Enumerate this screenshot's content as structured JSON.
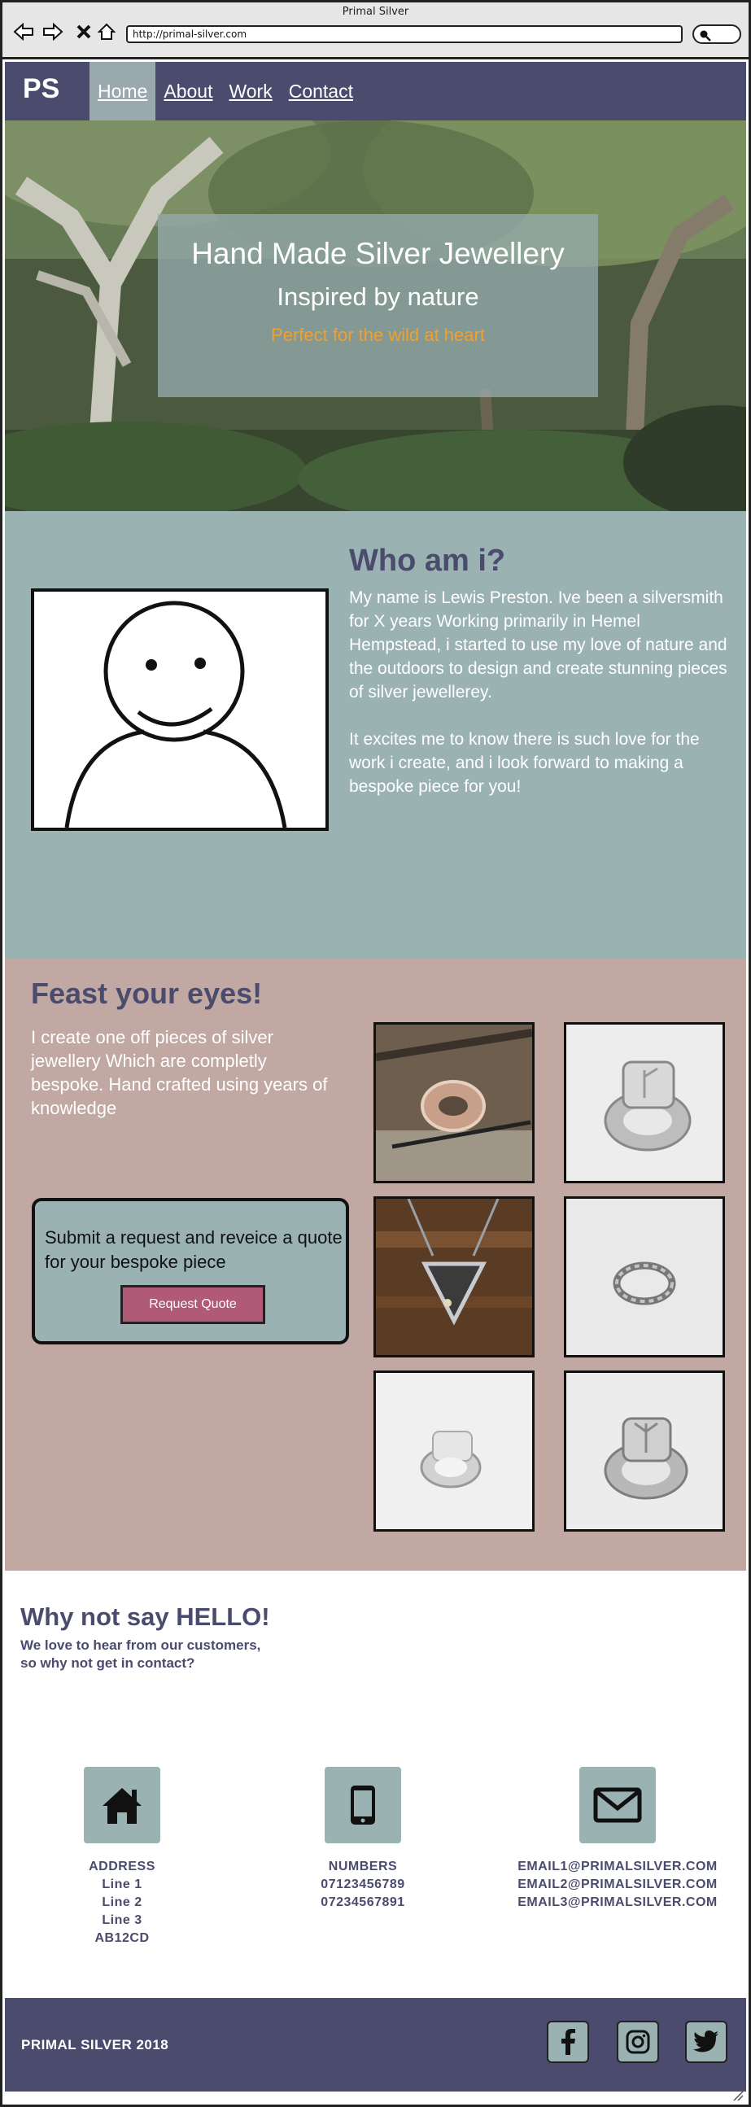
{
  "window": {
    "title": "Primal Silver",
    "url": "http://primal-silver.com"
  },
  "nav": {
    "logo": "PS",
    "links": [
      {
        "label": "Home",
        "active": true
      },
      {
        "label": "About",
        "active": false
      },
      {
        "label": "Work",
        "active": false
      },
      {
        "label": "Contact",
        "active": false
      }
    ]
  },
  "hero": {
    "title": "Hand Made Silver Jewellery",
    "subtitle": "Inspired by nature",
    "tagline": "Perfect for the wild at heart"
  },
  "about": {
    "heading": "Who am i?",
    "paragraph1": "My name is Lewis Preston. Ive been a silversmith for X years Working primarily in Hemel Hempstead, i started to use my love of nature and the outdoors to design and create stunning pieces of silver jewellerey.",
    "paragraph2": "It excites me to know there is such love for the work i create, and i look forward to making a bespoke piece for you!"
  },
  "work": {
    "heading": "Feast your eyes!",
    "text": "I create one off pieces of silver jewellery Which are completly bespoke. Hand crafted using years of knowledge",
    "quote_text": "Submit a request and reveice a quote for your bespoke piece",
    "quote_button": "Request Quote"
  },
  "contact": {
    "heading": "Why not say HELLO!",
    "intro_line1": "We love to hear from our customers,",
    "intro_line2": "so why not get in contact?",
    "address": {
      "label": "ADDRESS",
      "lines": [
        "Line 1",
        "Line 2",
        "Line 3",
        "AB12CD"
      ],
      "icon": "home-icon"
    },
    "numbers": {
      "label": "NUMBERS",
      "lines": [
        "07123456789",
        "07234567891"
      ],
      "icon": "phone-icon"
    },
    "emails": {
      "lines": [
        "EMAIL1@PRIMALSILVER.COM",
        "EMAIL2@PRIMALSILVER.COM",
        "EMAIL3@PRIMALSILVER.COM"
      ],
      "icon": "envelope-icon"
    }
  },
  "footer": {
    "copyright": "PRIMAL SILVER 2018",
    "social_icons": [
      "facebook-icon",
      "instagram-icon",
      "twitter-icon"
    ]
  },
  "colors": {
    "navy": "#4a4b6d",
    "teal": "#9bb2b3",
    "rose": "#c2a8a3",
    "accent_orange": "#f0a030",
    "button_pink": "#b05a78"
  }
}
